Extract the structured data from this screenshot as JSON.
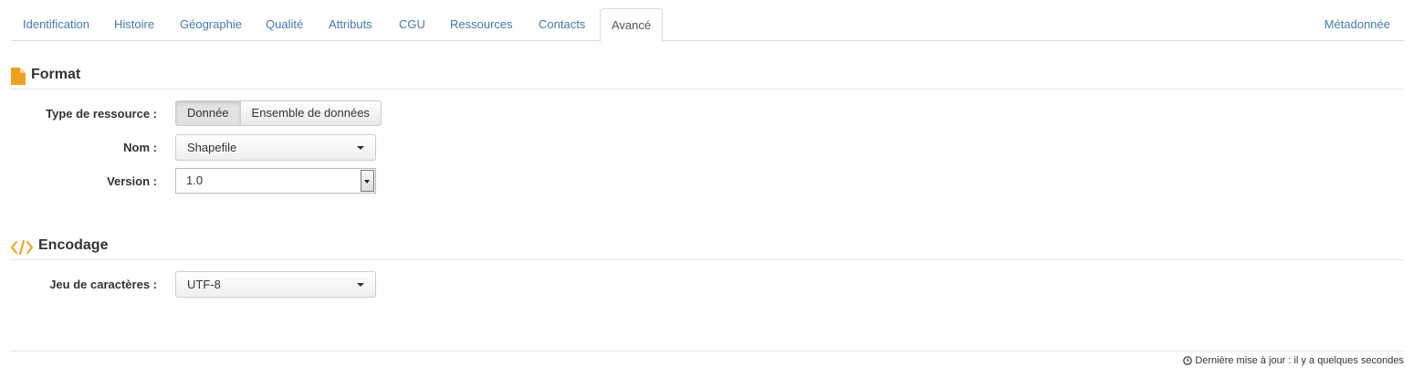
{
  "tabs": {
    "items": [
      "Identification",
      "Histoire",
      "Géographie",
      "Qualité",
      "Attributs",
      "CGU",
      "Ressources",
      "Contacts",
      "Avancé"
    ],
    "active": "Avancé",
    "right": "Métadonnée"
  },
  "format": {
    "title": "Format",
    "icon": "file-icon",
    "resource_type_label": "Type de ressource :",
    "resource_type_options": [
      "Donnée",
      "Ensemble de données"
    ],
    "resource_type_selected": "Donnée",
    "name_label": "Nom :",
    "name_value": "Shapefile",
    "version_label": "Version :",
    "version_value": "1.0"
  },
  "encoding": {
    "title": "Encodage",
    "icon": "code-icon",
    "charset_label": "Jeu de caractères :",
    "charset_value": "UTF-8"
  },
  "footer": {
    "icon": "clock-icon",
    "text": "Dernière mise à jour : il y a quelques secondes"
  },
  "colors": {
    "accent": "#f0a020",
    "link": "#4a78a8"
  }
}
